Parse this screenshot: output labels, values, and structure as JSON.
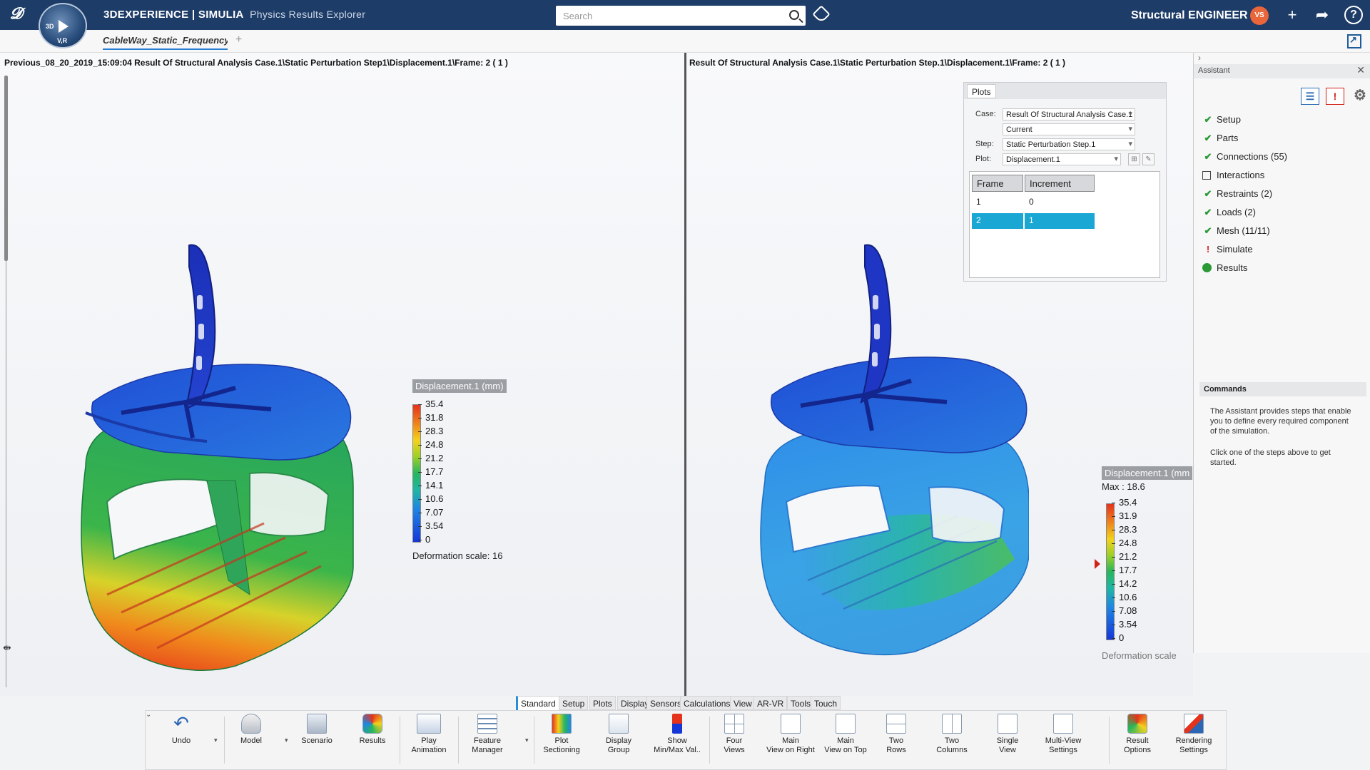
{
  "topbar": {
    "brand_bold": "3DEXPERIENCE | SIMULIA",
    "app_name": "Physics Results Explorer",
    "search_placeholder": "Search",
    "role": "Structural ENGINEER",
    "avatar_initials": "VS",
    "compass_labels": {
      "top": "3D",
      "v": "V,R"
    }
  },
  "tabs": {
    "document_tab": "CableWay_Static_Frequency",
    "add_tab": "+"
  },
  "left_view": {
    "title": "Previous_08_20_2019_15:09:04 Result Of Structural Analysis Case.1\\Static Perturbation Step1\\Displacement.1\\Frame: 2 ( 1 )",
    "legend": {
      "title": "Displacement.1 (mm)",
      "ticks": [
        "35.4",
        "31.8",
        "28.3",
        "24.8",
        "21.2",
        "17.7",
        "14.1",
        "10.6",
        "7.07",
        "3.54",
        "0"
      ],
      "deformation_scale": "Deformation scale: 16"
    }
  },
  "right_view": {
    "title": "Result Of Structural Analysis Case.1\\Static Perturbation Step.1\\Displacement.1\\Frame: 2 ( 1 )",
    "legend": {
      "title": "Displacement.1 (mm",
      "max": "Max : 18.6",
      "ticks": [
        "35.4",
        "31.9",
        "28.3",
        "24.8",
        "21.2",
        "17.7",
        "14.2",
        "10.6",
        "7.08",
        "3.54",
        "0"
      ],
      "deformation_scale": "Deformation scale"
    }
  },
  "plots_panel": {
    "tab": "Plots",
    "case_label": "Case:",
    "case_value": "Result Of Structural Analysis Case.1",
    "current_value": "Current",
    "step_label": "Step:",
    "step_value": "Static Perturbation Step.1",
    "plot_label": "Plot:",
    "plot_value": "Displacement.1",
    "columns": [
      "Frame",
      "Increment"
    ],
    "rows": [
      {
        "frame": "1",
        "increment": "0"
      },
      {
        "frame": "2",
        "increment": "1"
      }
    ]
  },
  "assistant": {
    "title": "Assistant",
    "steps": [
      {
        "label": "Setup",
        "status": "check"
      },
      {
        "label": "Parts",
        "status": "check"
      },
      {
        "label": "Connections (55)",
        "status": "check"
      },
      {
        "label": "Interactions",
        "status": "box"
      },
      {
        "label": "Restraints (2)",
        "status": "check"
      },
      {
        "label": "Loads (2)",
        "status": "check"
      },
      {
        "label": "Mesh (11/11)",
        "status": "check"
      },
      {
        "label": "Simulate",
        "status": "warn"
      },
      {
        "label": "Results",
        "status": "dot"
      }
    ],
    "commands_title": "Commands",
    "commands_text1": "The Assistant provides steps that enable you to define every required component of the simulation.",
    "commands_text2": "Click one of the steps above to get started."
  },
  "action_tabs": [
    "Standard",
    "Setup",
    "Plots",
    "Display",
    "Sensors",
    "Calculations",
    "View",
    "AR-VR",
    "Tools",
    "Touch"
  ],
  "toolbar": {
    "undo": "Undo",
    "model": "Model",
    "scenario": "Scenario",
    "results": "Results",
    "play_animation": [
      "Play",
      "Animation"
    ],
    "feature_manager": [
      "Feature",
      "Manager"
    ],
    "plot_sectioning": [
      "Plot",
      "Sectioning"
    ],
    "display_group": [
      "Display",
      "Group"
    ],
    "show_minmax": [
      "Show",
      "Min/Max Val.."
    ],
    "four_views": [
      "Four",
      "Views"
    ],
    "main_right": [
      "Main",
      "View on Right"
    ],
    "main_top": [
      "Main",
      "View on Top"
    ],
    "two_rows": [
      "Two",
      "Rows"
    ],
    "two_columns": [
      "Two",
      "Columns"
    ],
    "single_view": [
      "Single",
      "View"
    ],
    "multiview_settings": [
      "Multi-View",
      "Settings"
    ],
    "result_options": [
      "Result",
      "Options"
    ],
    "rendering_settings": [
      "Rendering",
      "Settings"
    ]
  },
  "colors": {
    "topbar": "#1d3c68",
    "selection": "#1ba7d4",
    "check": "#2a9a35",
    "warn": "#d1221a"
  }
}
